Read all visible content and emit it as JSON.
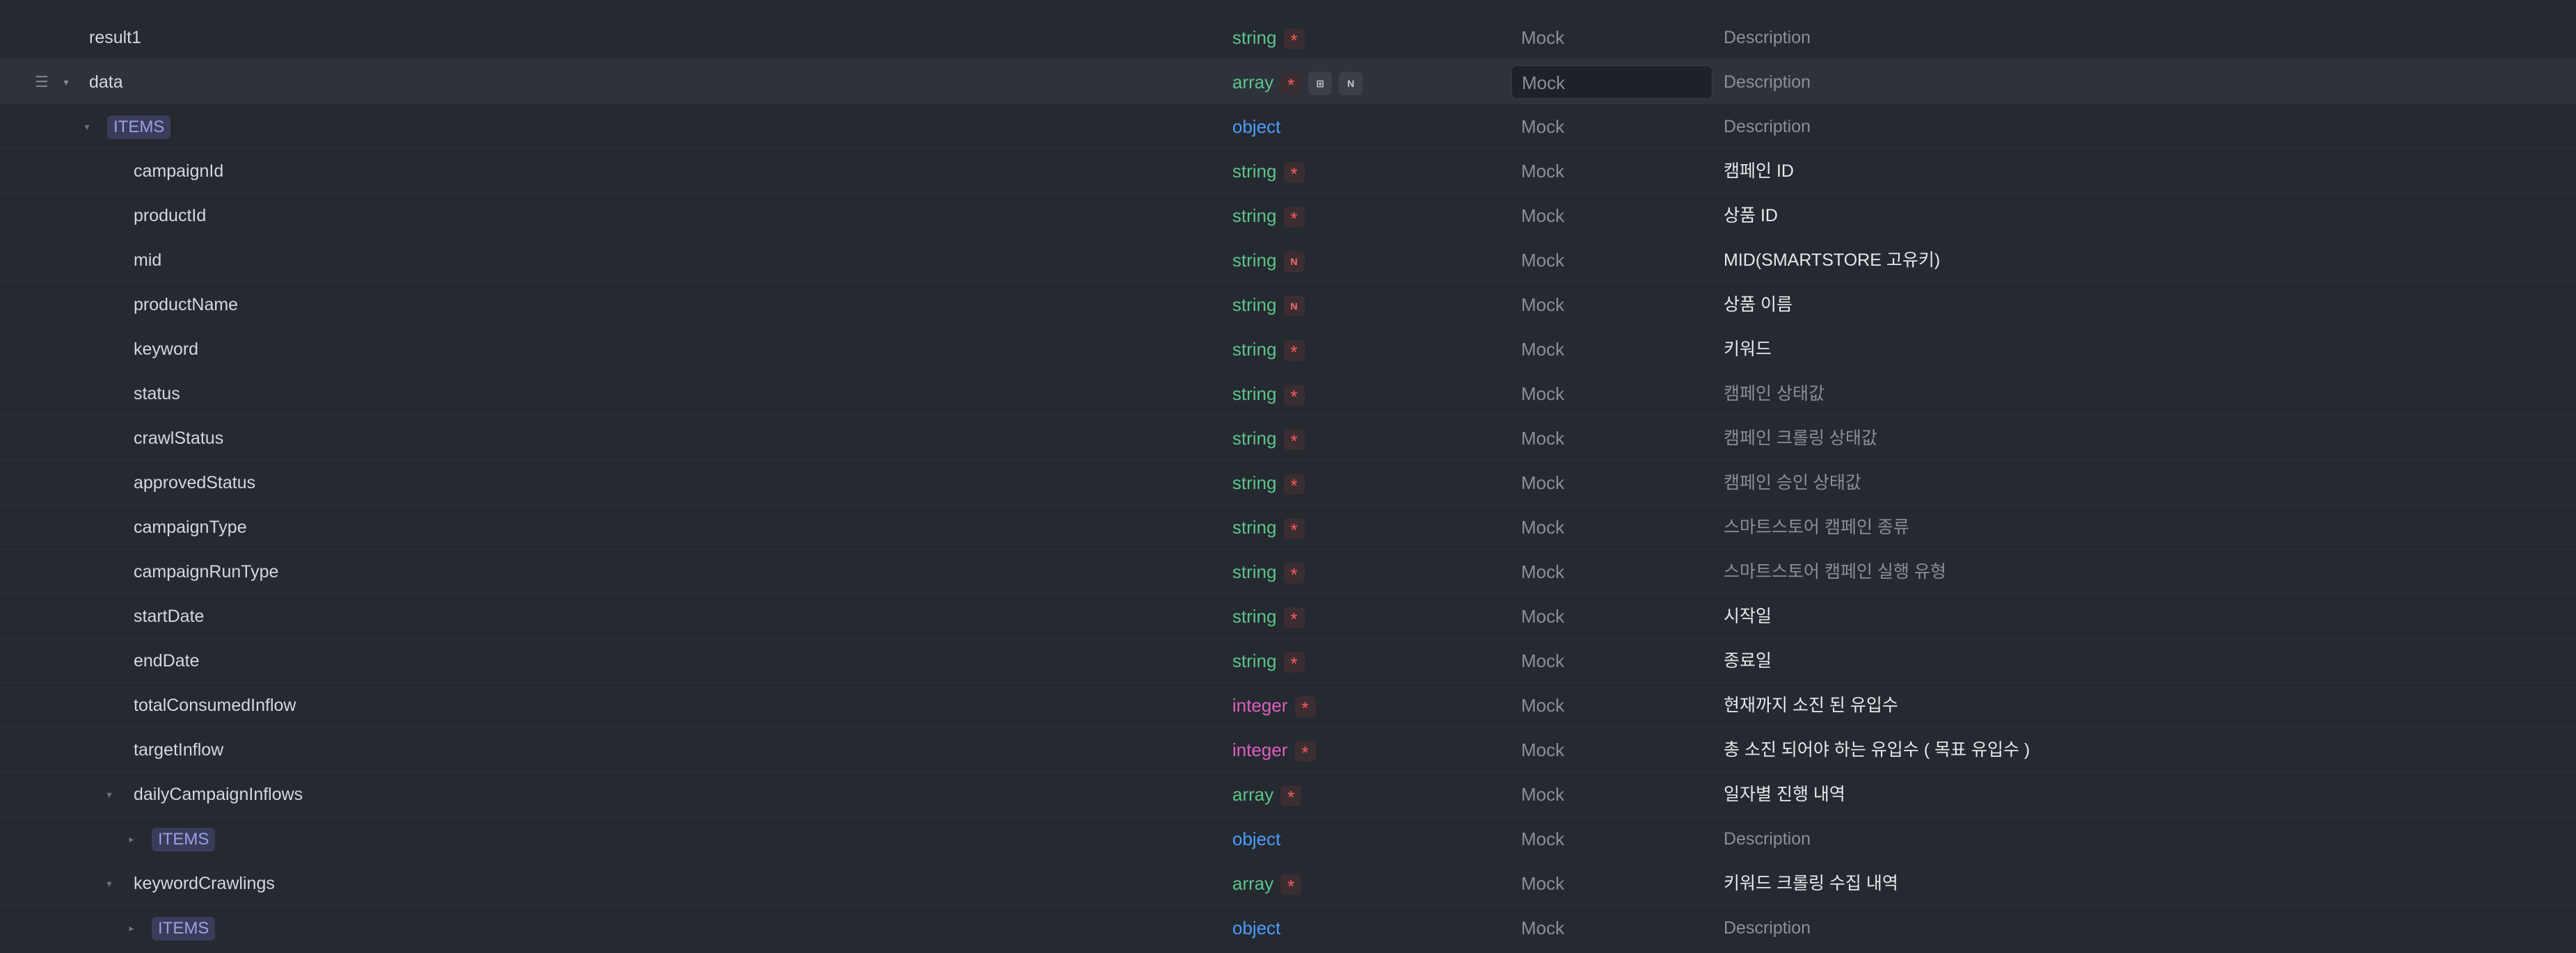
{
  "mock_placeholder": "Mock",
  "description_placeholder": "Description",
  "rows": [
    {
      "name": "result1",
      "indent": 0,
      "type": "string",
      "required": true,
      "nullable": false,
      "description": "",
      "desc_style": "placeholder"
    },
    {
      "name": "data",
      "indent": 0,
      "type": "array",
      "required": true,
      "nullable": true,
      "has_chip": true,
      "expanded": true,
      "highlighted": true,
      "description": "",
      "desc_style": "placeholder"
    },
    {
      "name": "ITEMS",
      "indent": 1,
      "type": "object",
      "required": false,
      "nullable": false,
      "is_items": true,
      "expanded": true,
      "description": "",
      "desc_style": "placeholder"
    },
    {
      "name": "campaignId",
      "indent": 2,
      "type": "string",
      "required": true,
      "nullable": false,
      "description": "캠페인 ID",
      "desc_style": "normal"
    },
    {
      "name": "productId",
      "indent": 2,
      "type": "string",
      "required": true,
      "nullable": false,
      "description": "상품 ID",
      "desc_style": "normal"
    },
    {
      "name": "mid",
      "indent": 2,
      "type": "string",
      "required": false,
      "nullable": true,
      "description": "MID(SMARTSTORE  고유키)",
      "desc_style": "normal"
    },
    {
      "name": "productName",
      "indent": 2,
      "type": "string",
      "required": false,
      "nullable": true,
      "description": "상품 이름",
      "desc_style": "normal"
    },
    {
      "name": "keyword",
      "indent": 2,
      "type": "string",
      "required": true,
      "nullable": false,
      "description": "키워드",
      "desc_style": "normal"
    },
    {
      "name": "status",
      "indent": 2,
      "type": "string",
      "required": true,
      "nullable": false,
      "description": "캠페인 상태값",
      "desc_style": "dim"
    },
    {
      "name": "crawlStatus",
      "indent": 2,
      "type": "string",
      "required": true,
      "nullable": false,
      "description": "캠페인 크롤링 상태값",
      "desc_style": "dim"
    },
    {
      "name": "approvedStatus",
      "indent": 2,
      "type": "string",
      "required": true,
      "nullable": false,
      "description": "캠페인 승인 상태값",
      "desc_style": "dim"
    },
    {
      "name": "campaignType",
      "indent": 2,
      "type": "string",
      "required": true,
      "nullable": false,
      "description": "스마트스토어 캠페인 종류",
      "desc_style": "dim"
    },
    {
      "name": "campaignRunType",
      "indent": 2,
      "type": "string",
      "required": true,
      "nullable": false,
      "description": "스마트스토어 캠페인 실행 유형",
      "desc_style": "dim"
    },
    {
      "name": "startDate",
      "indent": 2,
      "type": "string",
      "required": true,
      "nullable": false,
      "description": "시작일",
      "desc_style": "normal"
    },
    {
      "name": "endDate",
      "indent": 2,
      "type": "string",
      "required": true,
      "nullable": false,
      "description": "종료일",
      "desc_style": "normal"
    },
    {
      "name": "totalConsumedInflow",
      "indent": 2,
      "type": "integer",
      "required": true,
      "nullable": false,
      "description": "현재까지 소진 된 유입수",
      "desc_style": "normal"
    },
    {
      "name": "targetInflow",
      "indent": 2,
      "type": "integer",
      "required": true,
      "nullable": false,
      "description": "총 소진 되어야 하는 유입수 ( 목표 유입수 )",
      "desc_style": "normal"
    },
    {
      "name": "dailyCampaignInflows",
      "indent": 2,
      "type": "array",
      "required": true,
      "nullable": false,
      "expandable": true,
      "expanded": true,
      "description": "일자별 진행 내역",
      "desc_style": "normal"
    },
    {
      "name": "ITEMS",
      "indent": 3,
      "type": "object",
      "required": false,
      "nullable": false,
      "is_items": true,
      "expandable": true,
      "expanded": false,
      "description": "",
      "desc_style": "placeholder"
    },
    {
      "name": "keywordCrawlings",
      "indent": 2,
      "type": "array",
      "required": true,
      "nullable": false,
      "expandable": true,
      "expanded": true,
      "description": "키워드 크롤링 수집 내역",
      "desc_style": "normal"
    },
    {
      "name": "ITEMS",
      "indent": 3,
      "type": "object",
      "required": false,
      "nullable": false,
      "is_items": true,
      "expandable": true,
      "expanded": false,
      "description": "",
      "desc_style": "placeholder"
    }
  ],
  "icons": {
    "required": "asterisk-icon",
    "nullable": "nullable-n-icon",
    "items_chip": "items-schema-icon",
    "drag": "drag-handle-icon",
    "collapse": "caret-down-icon",
    "expand": "caret-right-icon"
  },
  "labels": {
    "nullable_letter": "N",
    "required_symbol": "*"
  }
}
